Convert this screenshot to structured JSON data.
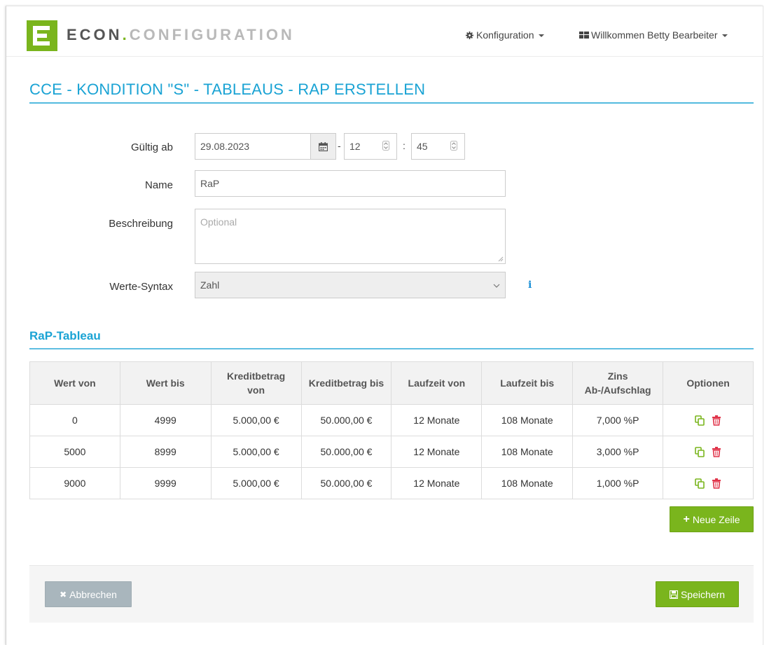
{
  "brand": {
    "part1": "ECON",
    "dot": ".",
    "part2": "CONFIGURATION"
  },
  "nav": {
    "config_label": "Konfiguration",
    "user_label": "Willkommen Betty Bearbeiter"
  },
  "page_title": "CCE - KONDITION \"S\" - TABLEAUS - RAP ERSTELLEN",
  "form": {
    "valid_from_label": "Gültig ab",
    "valid_from_date": "29.08.2023",
    "hour": "12",
    "minute": "45",
    "date_sep": "-",
    "time_sep": ":",
    "name_label": "Name",
    "name_value": "RaP",
    "description_label": "Beschreibung",
    "description_placeholder": "Optional",
    "syntax_label": "Werte-Syntax",
    "syntax_value": "Zahl",
    "info_icon": "i"
  },
  "section_title": "RaP-Tableau",
  "table": {
    "headers": [
      "Wert von",
      "Wert bis",
      "Kreditbetrag von",
      "Kreditbetrag bis",
      "Laufzeit von",
      "Laufzeit bis",
      "Zins Ab-/Aufschlag",
      "Optionen"
    ],
    "header_lines": {
      "kredit_von_1": "Kreditbetrag",
      "kredit_von_2": "von",
      "zins_1": "Zins",
      "zins_2": "Ab-/Aufschlag"
    },
    "rows": [
      [
        "0",
        "4999",
        "5.000,00 €",
        "50.000,00 €",
        "12 Monate",
        "108 Monate",
        "7,000 %P"
      ],
      [
        "5000",
        "8999",
        "5.000,00 €",
        "50.000,00 €",
        "12 Monate",
        "108 Monate",
        "3,000 %P"
      ],
      [
        "9000",
        "9999",
        "5.000,00 €",
        "50.000,00 €",
        "12 Monate",
        "108 Monate",
        "1,000 %P"
      ]
    ]
  },
  "buttons": {
    "new_row": "Neue Zeile",
    "new_row_icon": "+",
    "cancel": "Abbrechen",
    "cancel_icon": "✖",
    "save": "Speichern"
  },
  "colors": {
    "accent_blue": "#1aa3d4",
    "brand_green": "#7ab51d",
    "delete_red": "#e0344a",
    "cancel_grey": "#a9b6bd"
  },
  "icons": [
    "gear-icon",
    "grid-icon",
    "calendar-icon",
    "copy-icon",
    "trash-icon",
    "save-icon",
    "info-icon",
    "chevron-down-icon"
  ]
}
